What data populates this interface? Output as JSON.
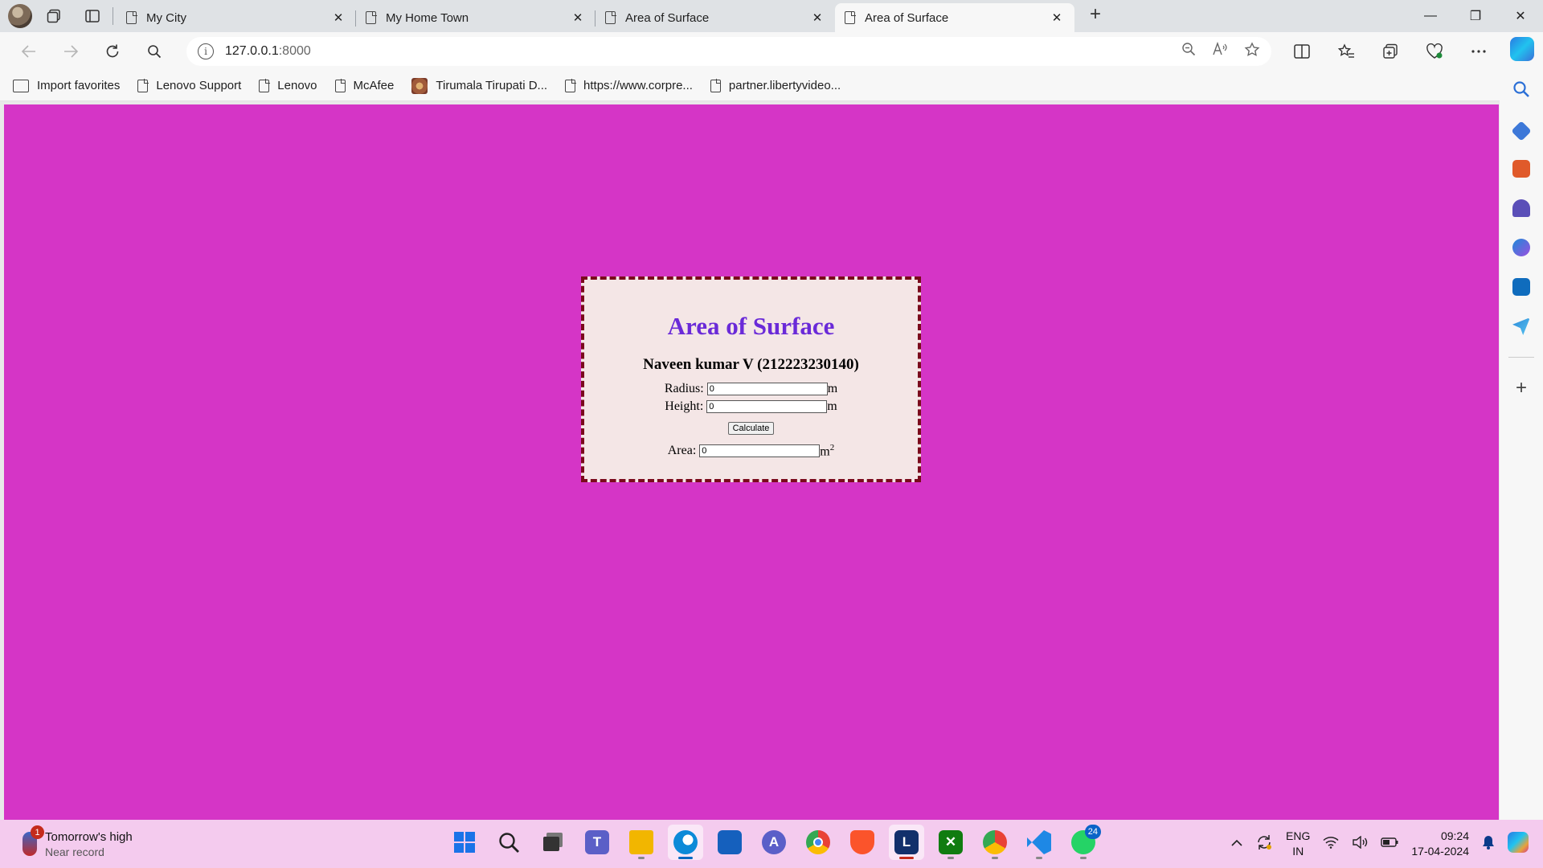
{
  "browser": {
    "tabs": [
      {
        "label": "My City",
        "active": false
      },
      {
        "label": "My Home Town",
        "active": false
      },
      {
        "label": "Area of Surface",
        "active": false
      },
      {
        "label": "Area of Surface",
        "active": true
      }
    ],
    "new_tab": "+",
    "close_glyph": "✕",
    "window_controls": {
      "minimize": "—",
      "restore": "❐",
      "close": "✕"
    },
    "address": {
      "host": "127.0.0.1",
      "port": ":8000"
    },
    "favorites": [
      "Import favorites",
      "Lenovo Support",
      "Lenovo",
      "McAfee",
      "Tirumala Tirupati D...",
      "https://www.corpre...",
      "partner.libertyvideo..."
    ]
  },
  "page": {
    "background": "#d535c6",
    "heading": "Area of Surface",
    "heading_color": "#6a2ad8",
    "author": "Naveen kumar V (212223230140)",
    "radius": {
      "label": "Radius:",
      "value": "0",
      "unit": "m"
    },
    "height": {
      "label": "Height:",
      "value": "0",
      "unit": "m"
    },
    "calculate_label": "Calculate",
    "area": {
      "label": "Area:",
      "value": "0",
      "unit": "m",
      "unit_exponent": "2"
    }
  },
  "taskbar": {
    "weather": {
      "line1": "Tomorrow's high",
      "line2": "Near record",
      "badge": "1"
    },
    "apps": [
      {
        "name": "start",
        "color": "#1a73e8"
      },
      {
        "name": "search",
        "color": "#222222"
      },
      {
        "name": "task-view",
        "color": "#333333"
      },
      {
        "name": "teams",
        "color": "#5b5fc7"
      },
      {
        "name": "file-explorer",
        "color": "#f2b600"
      },
      {
        "name": "edge",
        "color": "#0c8ad8"
      },
      {
        "name": "store",
        "color": "#1560bd"
      },
      {
        "name": "app-a",
        "color": "#5a5fc8"
      },
      {
        "name": "chrome",
        "color": "#e94235"
      },
      {
        "name": "brave",
        "color": "#fb542b"
      },
      {
        "name": "l-app",
        "color": "#12306b",
        "text": "L"
      },
      {
        "name": "xbox",
        "color": "#107c10"
      },
      {
        "name": "chrome-profile",
        "color": "#34a853"
      },
      {
        "name": "vscode",
        "color": "#1e88e5"
      },
      {
        "name": "whatsapp",
        "color": "#25d366",
        "badge": "24"
      }
    ],
    "tray": {
      "lang1": "ENG",
      "lang2": "IN",
      "time": "09:24",
      "date": "17-04-2024"
    }
  }
}
